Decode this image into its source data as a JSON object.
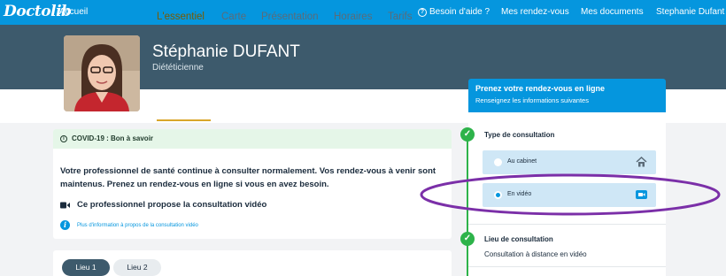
{
  "nav": {
    "logo": "Doctolib",
    "home": "Accueil",
    "help": "Besoin d'aide ?",
    "appointments": "Mes rendez-vous",
    "documents": "Mes documents",
    "user": "Stephanie Dufant",
    "help_icon_glyph": "?"
  },
  "profile": {
    "name": "Stéphanie DUFANT",
    "specialty": "Diététicienne",
    "tabs": [
      {
        "label": "L'essentiel",
        "active": true
      },
      {
        "label": "Carte"
      },
      {
        "label": "Présentation"
      },
      {
        "label": "Horaires"
      },
      {
        "label": "Tarifs"
      }
    ]
  },
  "covid": {
    "title": "COVID-19 : Bon à savoir",
    "message": "Votre professionnel de santé continue à consulter normalement. Vos rendez-vous à venir sont maintenus. Prenez un rendez-vous en ligne si vous en avez besoin.",
    "video_notice": "Ce professionnel propose la consultation vidéo",
    "info_link": "Plus d'information à propos de la consultation vidéo"
  },
  "locations": {
    "pills": [
      "Lieu 1",
      "Lieu 2"
    ],
    "selected": "Lieu 1"
  },
  "booking": {
    "title": "Prenez votre rendez-vous en ligne",
    "subtitle": "Renseignez les informations suivantes",
    "step1_title": "Type de consultation",
    "options": [
      {
        "label": "Au cabinet",
        "icon": "house-icon",
        "selected": false
      },
      {
        "label": "En vidéo",
        "icon": "video-camera-icon",
        "selected": true
      }
    ],
    "step2_title": "Lieu de consultation",
    "step2_value": "Consultation à distance en vidéo"
  },
  "colors": {
    "primary": "#0596de",
    "header_band": "#3d5a6c",
    "success": "#2db34a",
    "annotation": "#7b2fa8",
    "tab_accent": "#d9a62a"
  }
}
